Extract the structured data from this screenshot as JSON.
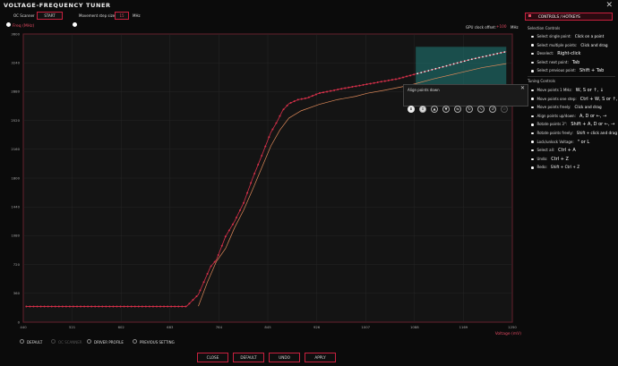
{
  "window": {
    "title": "VOLTAGE-FREQUENCY TUNER"
  },
  "toolbar": {
    "oc_scanner_label": "OC Scanner",
    "start_label": "START",
    "step_size_label": "Movement step size:",
    "step_size_value": "15",
    "step_unit": "MHz"
  },
  "chart_header": {
    "freq_label": "Freq (MHz)",
    "gpu_offset_label": "GPU clock offset:",
    "gpu_offset_value": "+100",
    "gpu_offset_unit": "MHz"
  },
  "align_popup": {
    "title": "Align points down",
    "icons": [
      "align-down-icon",
      "align-center-icon",
      "up-icon",
      "down-icon",
      "flat-icon",
      "rotate-icon",
      "curve-icon",
      "rotate-alt-icon",
      "disabled-icon"
    ]
  },
  "right_panel": {
    "header": "CONTROLS / HOTKEYS",
    "selection_title": "Selection Controls",
    "selection": [
      {
        "label": "Select single point:",
        "key": "Click on a point"
      },
      {
        "label": "Select multiple points:",
        "key": "Click and drag"
      },
      {
        "label": "Deselect:",
        "key": "Right-click"
      },
      {
        "label": "Select next point:",
        "key": "Tab"
      },
      {
        "label": "Select previous point:",
        "key": "Shift + Tab"
      }
    ],
    "tuning_title": "Tuning Controls",
    "tuning": [
      {
        "label": "Move points 1 MHz:",
        "key": "W, S or ↑, ↓"
      },
      {
        "label": "Move points one step:",
        "key": "Ctrl + W, S or ↑, ↓"
      },
      {
        "label": "Move points freely:",
        "key": "Click and drag"
      },
      {
        "label": "Align points up/down:",
        "key": "A, D or ←, →"
      },
      {
        "label": "Rotate points 3°:",
        "key": "Shift + A, D or ←, →"
      },
      {
        "label": "Rotate points freely:",
        "key": "Shift + click and drag"
      },
      {
        "label": "Lock/unlock Voltage:",
        "key": "\" or L"
      },
      {
        "label": "Select all:",
        "key": "Ctrl + A"
      },
      {
        "label": "Undo:",
        "key": "Ctrl + Z"
      },
      {
        "label": "Redo:",
        "key": "Shift + Ctrl + Z"
      }
    ]
  },
  "profiles": [
    {
      "label": "DEFAULT",
      "selected": false,
      "enabled": true
    },
    {
      "label": "OC SCANNER",
      "selected": false,
      "enabled": false
    },
    {
      "label": "DRIVER PROFILE",
      "selected": false,
      "enabled": true
    },
    {
      "label": "PREVIOUS SETTING",
      "selected": false,
      "enabled": true
    }
  ],
  "footer": {
    "close": "CLOSE",
    "default": "DEFAULT",
    "undo": "UNDO",
    "apply": "APPLY"
  },
  "colors": {
    "accent": "#c8203e",
    "curve_main": "#d8304a",
    "curve_default": "#e08a5a",
    "selection": "#1f7e7a"
  },
  "chart_data": {
    "type": "line",
    "title": "",
    "xlabel": "Voltage (mV)",
    "ylabel": "Freq (MHz)",
    "xlim": [
      440,
      1250
    ],
    "ylim": [
      0,
      3600
    ],
    "x_ticks": [
      440,
      521,
      602,
      683,
      764,
      845,
      926,
      1007,
      1088,
      1169,
      1250
    ],
    "y_ticks": [
      0,
      360,
      720,
      1080,
      1440,
      1800,
      2160,
      2520,
      2880,
      3240,
      3600
    ],
    "series": [
      {
        "name": "",
        "points": [
          [
            445,
            195
          ],
          [
            700,
            195
          ],
          [
            710,
            195
          ],
          [
            730,
            345
          ],
          [
            750,
            690
          ],
          [
            760,
            780
          ],
          [
            775,
            1070
          ],
          [
            790,
            1260
          ],
          [
            805,
            1490
          ],
          [
            820,
            1800
          ],
          [
            835,
            2080
          ],
          [
            850,
            2370
          ],
          [
            860,
            2500
          ],
          [
            870,
            2650
          ],
          [
            880,
            2730
          ],
          [
            895,
            2780
          ],
          [
            910,
            2800
          ],
          [
            930,
            2860
          ],
          [
            950,
            2890
          ],
          [
            970,
            2920
          ],
          [
            1000,
            2960
          ],
          [
            1030,
            3000
          ],
          [
            1060,
            3040
          ],
          [
            1090,
            3100
          ],
          [
            1120,
            3160
          ],
          [
            1150,
            3220
          ],
          [
            1180,
            3280
          ],
          [
            1210,
            3330
          ],
          [
            1240,
            3380
          ]
        ]
      },
      {
        "name": "",
        "points": [
          [
            730,
            200
          ],
          [
            745,
            500
          ],
          [
            760,
            760
          ],
          [
            775,
            920
          ],
          [
            790,
            1180
          ],
          [
            805,
            1400
          ],
          [
            820,
            1660
          ],
          [
            835,
            1930
          ],
          [
            850,
            2200
          ],
          [
            865,
            2400
          ],
          [
            880,
            2550
          ],
          [
            900,
            2640
          ],
          [
            930,
            2720
          ],
          [
            960,
            2780
          ],
          [
            990,
            2820
          ],
          [
            1010,
            2860
          ],
          [
            1040,
            2900
          ],
          [
            1080,
            2960
          ],
          [
            1120,
            3040
          ],
          [
            1160,
            3110
          ],
          [
            1200,
            3180
          ],
          [
            1240,
            3230
          ]
        ]
      }
    ],
    "selection_box": {
      "x": [
        1090,
        1240
      ],
      "y": [
        2880,
        3440
      ]
    }
  }
}
